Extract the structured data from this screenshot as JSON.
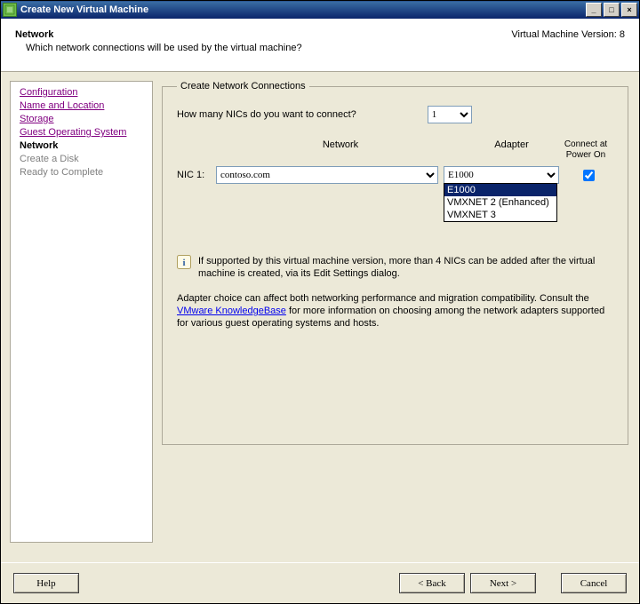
{
  "title": "Create New Virtual Machine",
  "version_label": "Virtual Machine Version: 8",
  "header": {
    "title": "Network",
    "sub": "Which network connections will be used by the virtual machine?"
  },
  "sidebar": {
    "items": [
      {
        "label": "Configuration",
        "state": "visited"
      },
      {
        "label": "Name and Location",
        "state": "visited"
      },
      {
        "label": "Storage",
        "state": "visited"
      },
      {
        "label": "Guest Operating System",
        "state": "visited"
      },
      {
        "label": "Network",
        "state": "current"
      },
      {
        "label": "Create a Disk",
        "state": "future"
      },
      {
        "label": "Ready to Complete",
        "state": "future"
      }
    ]
  },
  "group": {
    "legend": "Create Network Connections",
    "nic_question": "How many NICs do you want to connect?",
    "nic_count_value": "1",
    "col_network": "Network",
    "col_adapter": "Adapter",
    "col_poweron": "Connect at Power On",
    "nic1_label": "NIC 1:",
    "nic1_network": "contoso.com",
    "nic1_adapter": "E1000",
    "adapter_options": [
      "E1000",
      "VMXNET 2 (Enhanced)",
      "VMXNET 3"
    ],
    "info1": "If supported by this virtual machine version, more than 4 NICs can be added after the virtual machine is created, via its Edit Settings dialog.",
    "advice_pre": "Adapter choice can affect both networking performance and migration compatibility. Consult the ",
    "advice_link": "VMware KnowledgeBase",
    "advice_post": " for more information on choosing among the network adapters supported for various guest operating systems and hosts."
  },
  "buttons": {
    "help": "Help",
    "back": "< Back",
    "next": "Next >",
    "cancel": "Cancel"
  }
}
